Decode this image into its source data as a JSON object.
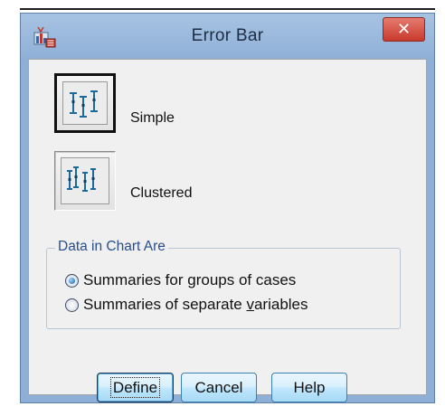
{
  "window": {
    "title": "Error Bar",
    "close_glyph": "✕",
    "app_icon": "chart-app-icon"
  },
  "chart_types": [
    {
      "label": "Simple",
      "icon": "simple-error-bar-icon",
      "selected": true
    },
    {
      "label": "Clustered",
      "icon": "clustered-error-bar-icon",
      "selected": false
    }
  ],
  "data_group": {
    "legend": "Data in Chart Are",
    "options": [
      {
        "before": "Summaries for ",
        "mnemonic": "g",
        "after": "roups of cases",
        "checked": true
      },
      {
        "before": "Summaries of separate ",
        "mnemonic": "v",
        "after": "ariables",
        "checked": false
      }
    ]
  },
  "buttons": {
    "define": "Define",
    "cancel": "Cancel",
    "help": "Help"
  },
  "colors": {
    "title_bar": "#8fb0d6",
    "close_button": "#c83a2c",
    "group_legend_text": "#284d8c",
    "button_face": "#bee6fd"
  }
}
